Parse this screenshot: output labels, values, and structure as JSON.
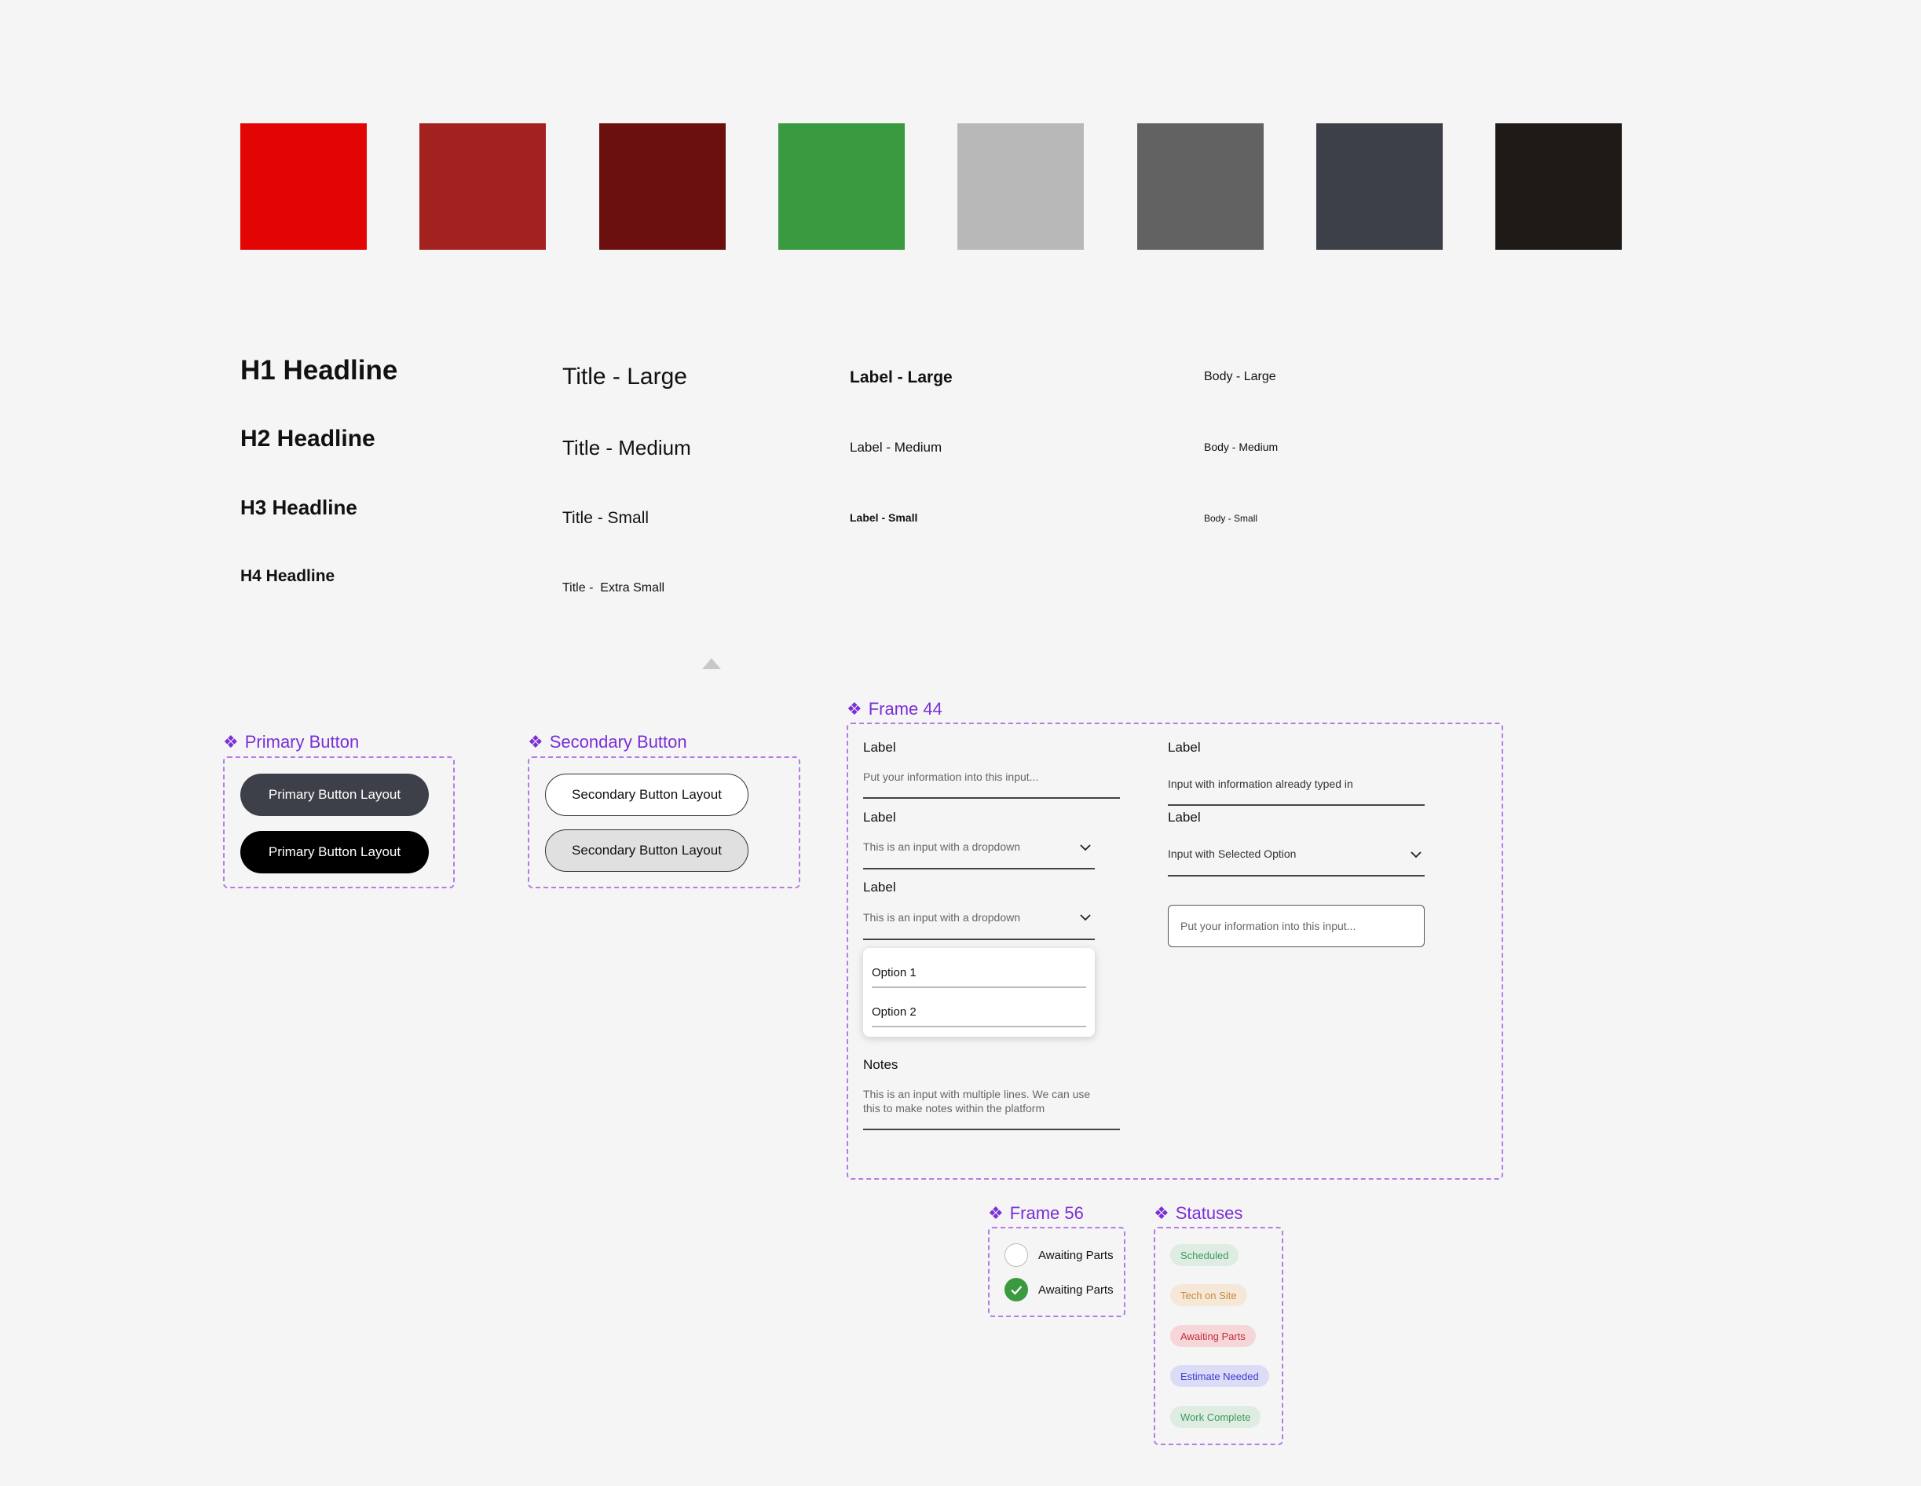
{
  "palette": [
    {
      "name": "red",
      "hex": "#e30404"
    },
    {
      "name": "dark-red",
      "hex": "#a3211f"
    },
    {
      "name": "maroon",
      "hex": "#6b0f0f"
    },
    {
      "name": "green",
      "hex": "#3a9a3f"
    },
    {
      "name": "light-gray",
      "hex": "#b8b8b8"
    },
    {
      "name": "gray",
      "hex": "#626262"
    },
    {
      "name": "charcoal",
      "hex": "#3e4049"
    },
    {
      "name": "near-black",
      "hex": "#1e1a18"
    }
  ],
  "typography": {
    "headlines": [
      "H1 Headline",
      "H2 Headline",
      "H3 Headline",
      "H4 Headline"
    ],
    "titles": [
      "Title - Large",
      "Title - Medium",
      "Title - Small",
      "Title -  Extra Small"
    ],
    "labels": [
      "Label - Large",
      "Label - Medium",
      "Label - Small"
    ],
    "bodies": [
      "Body - Large",
      "Body - Medium",
      "Body - Small"
    ]
  },
  "primary_button": {
    "title": "Primary Button",
    "buttons": [
      "Primary Button Layout",
      "Primary Button Layout"
    ]
  },
  "secondary_button": {
    "title": "Secondary Button",
    "buttons": [
      "Secondary Button Layout",
      "Secondary Button Layout"
    ]
  },
  "frame44": {
    "title": "Frame 44",
    "left": {
      "input1": {
        "label": "Label",
        "placeholder": "Put your information into this input..."
      },
      "dropdown1": {
        "label": "Label",
        "placeholder": "This is an input with a dropdown"
      },
      "dropdown2": {
        "label": "Label",
        "placeholder": "This is an input with a dropdown"
      },
      "options": [
        "Option 1",
        "Option 2"
      ],
      "notes": {
        "label": "Notes",
        "line1": "This is an input with multiple lines. We can use",
        "line2": "this to make notes within the platform"
      }
    },
    "right": {
      "input1": {
        "label": "Label",
        "value": "Input with information already typed in"
      },
      "dropdown1": {
        "label": "Label",
        "value": "Input with Selected Option"
      },
      "outlined": {
        "placeholder": "Put your information into this input..."
      }
    }
  },
  "frame56": {
    "title": "Frame 56",
    "items": [
      {
        "label": "Awaiting Parts",
        "checked": false
      },
      {
        "label": "Awaiting Parts",
        "checked": true
      }
    ]
  },
  "statuses": {
    "title": "Statuses",
    "items": [
      {
        "label": "Scheduled",
        "bg": "#dfece2",
        "fg": "#3a9a5f"
      },
      {
        "label": "Tech on Site",
        "bg": "#f6e8d8",
        "fg": "#c98a3a"
      },
      {
        "label": "Awaiting Parts",
        "bg": "#f6d6d8",
        "fg": "#c0303a"
      },
      {
        "label": "Estimate Needed",
        "bg": "#dcdcf6",
        "fg": "#3a3acf"
      },
      {
        "label": "Work Complete",
        "bg": "#dfece2",
        "fg": "#3a9a5f"
      }
    ]
  }
}
